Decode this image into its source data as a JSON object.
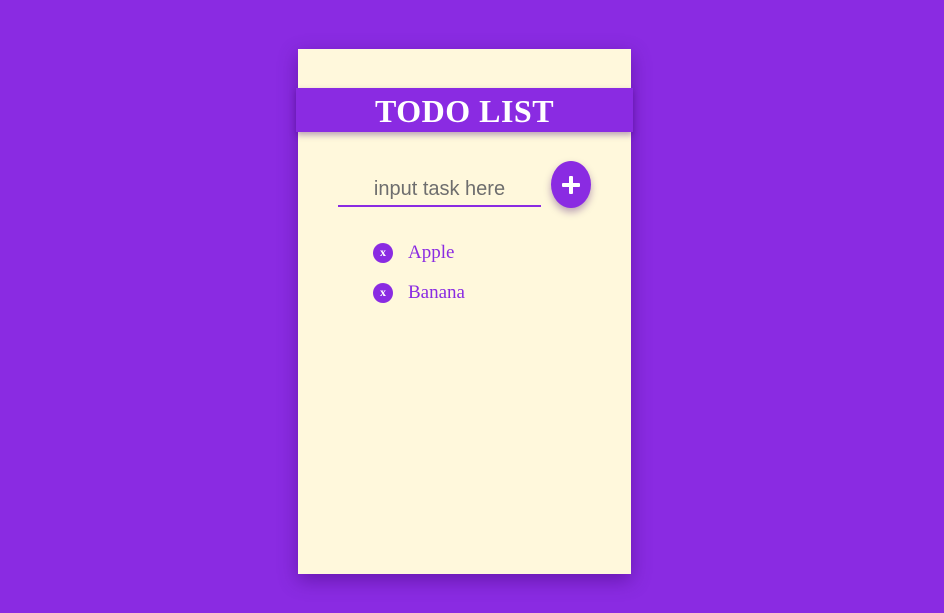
{
  "app": {
    "title": "TODO LIST"
  },
  "input": {
    "placeholder": "input task here",
    "value": ""
  },
  "add_button": {
    "icon": "plus-icon"
  },
  "todos": [
    {
      "delete_label": "x",
      "text": "Apple"
    },
    {
      "delete_label": "x",
      "text": "Banana"
    }
  ],
  "colors": {
    "background": "#8a2be2",
    "card": "#fff8dc",
    "accent": "#8a2be2",
    "text_light": "#ffffff"
  }
}
